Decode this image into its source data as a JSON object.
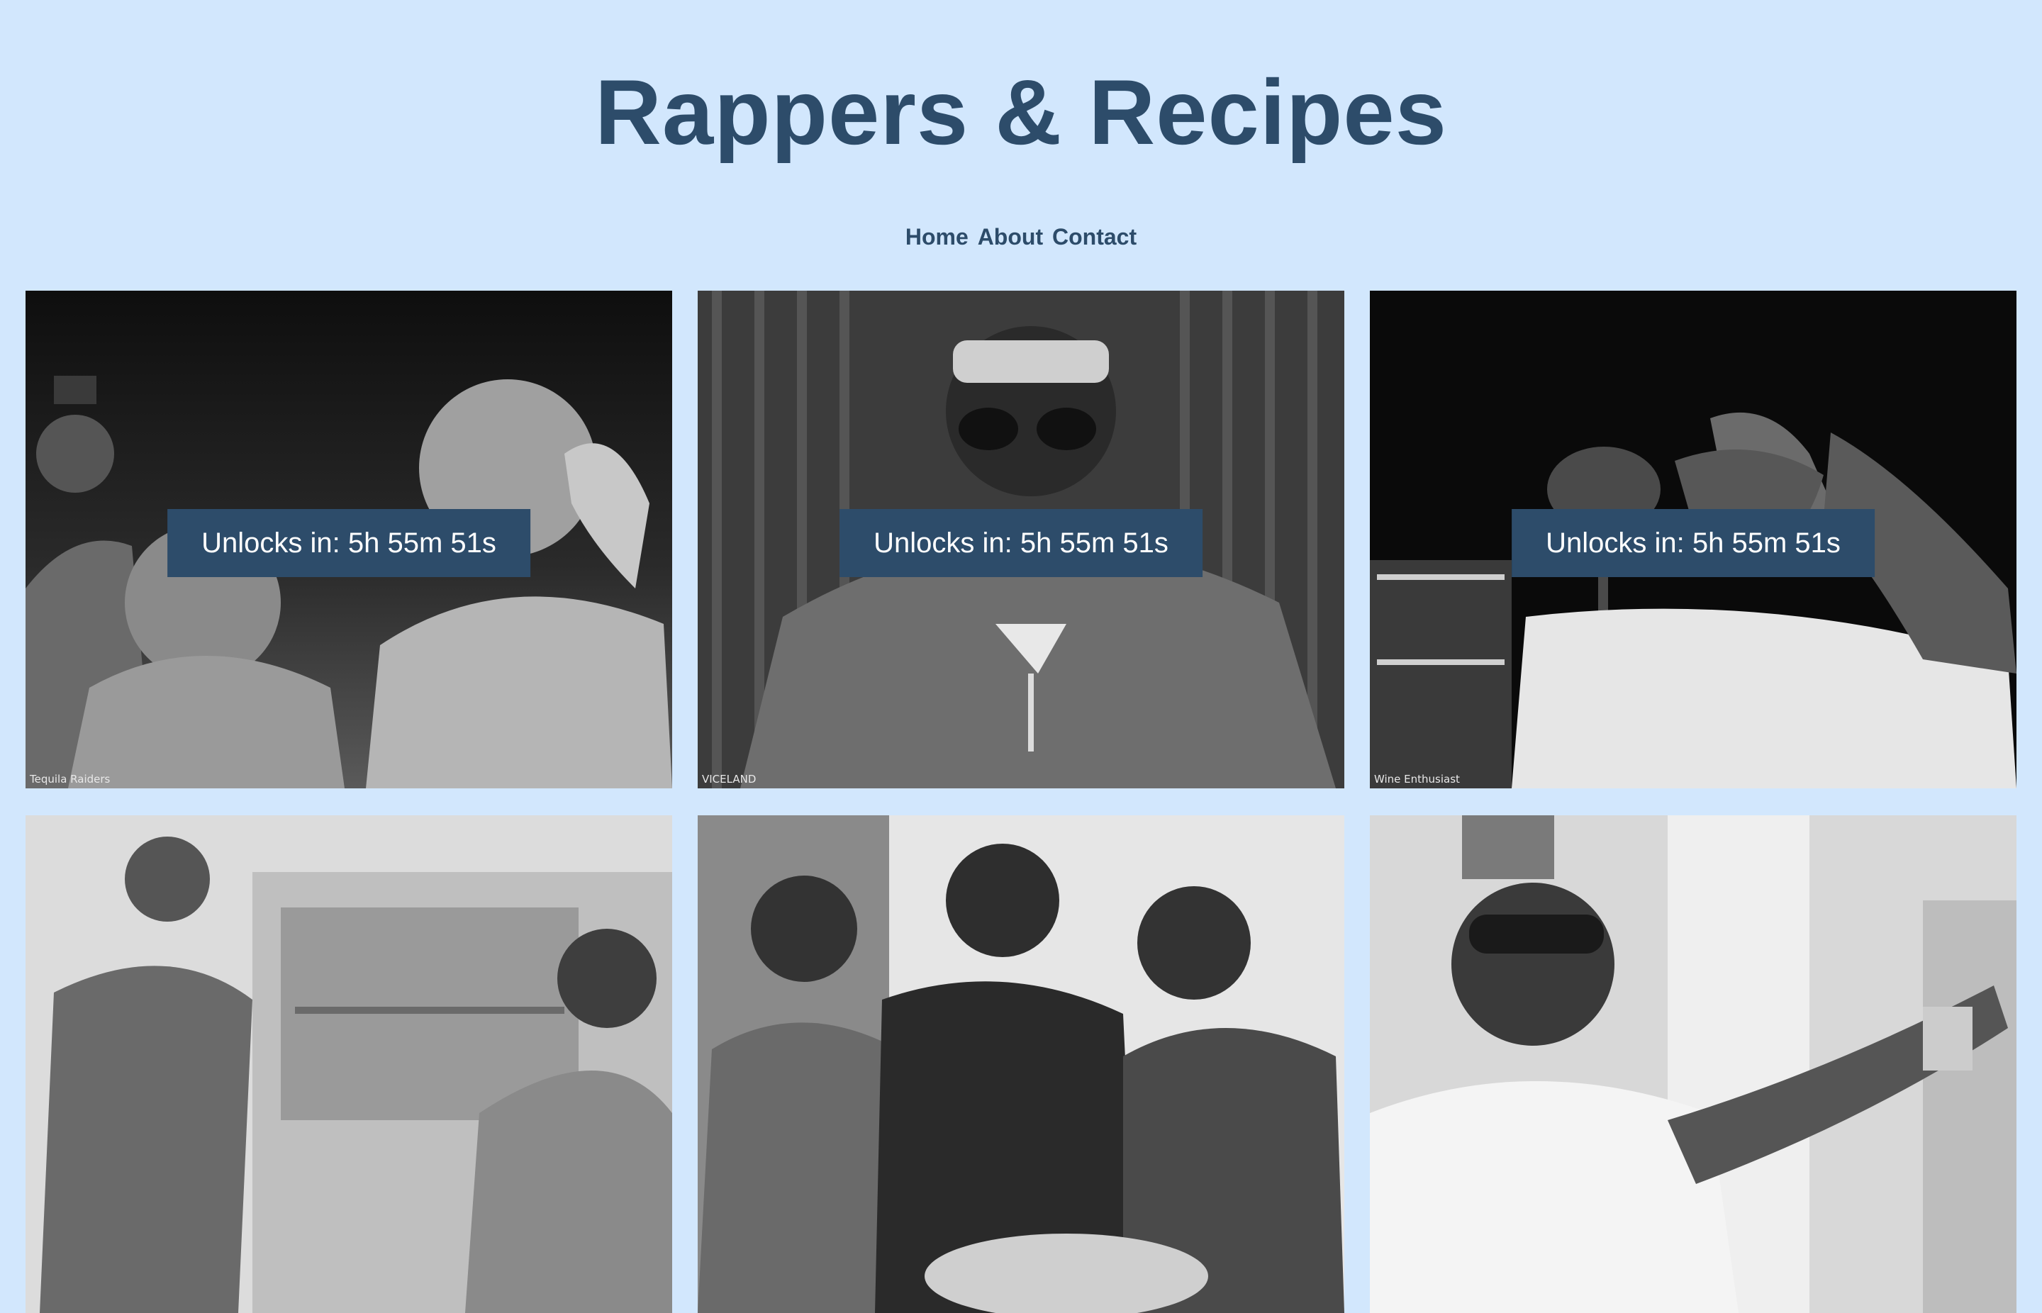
{
  "site": {
    "title": "Rappers & Recipes"
  },
  "nav": {
    "items": [
      "Home",
      "About",
      "Contact"
    ]
  },
  "cards": [
    {
      "unlock_text": "Unlocks in: 5h 55m 51s",
      "credit": "Tequila Raiders"
    },
    {
      "unlock_text": "Unlocks in: 5h 55m 51s",
      "credit": "VICELAND"
    },
    {
      "unlock_text": "Unlocks in: 5h 55m 51s",
      "credit": "Wine Enthusiast"
    },
    {
      "unlock_text": "",
      "credit": ""
    },
    {
      "unlock_text": "",
      "credit": ""
    },
    {
      "unlock_text": "",
      "credit": ""
    }
  ],
  "colors": {
    "background": "#d2e7fd",
    "accent": "#2d4c6a",
    "badge_text": "#ffffff"
  }
}
